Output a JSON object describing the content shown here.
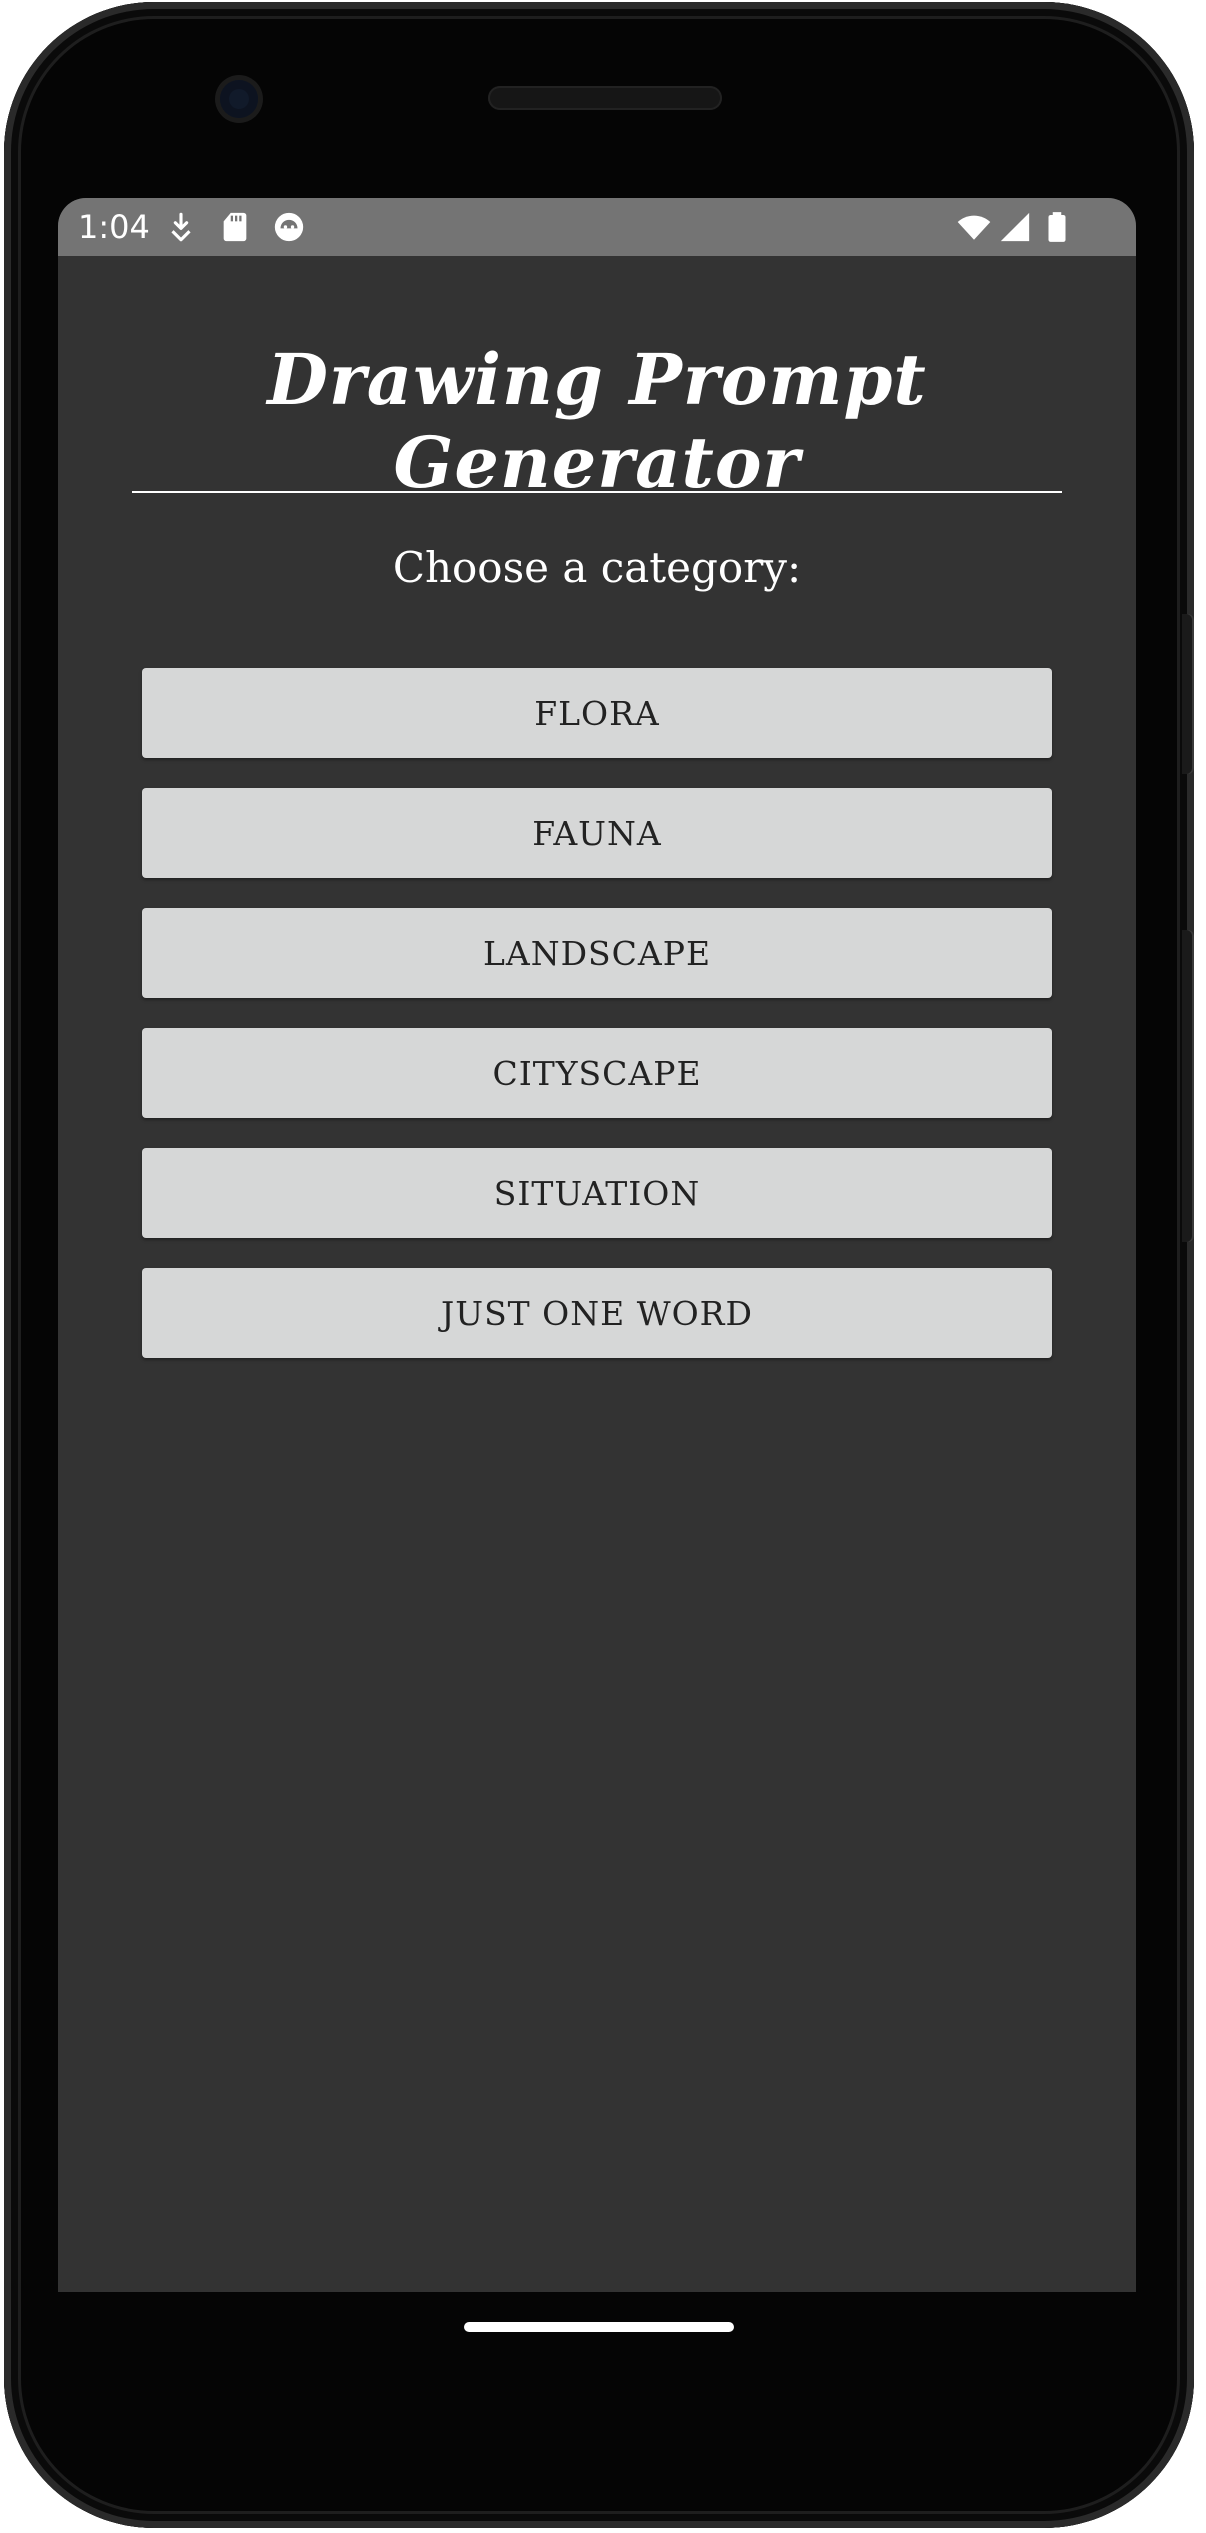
{
  "status_bar": {
    "time": "1:04",
    "left_icons": [
      "download-icon",
      "sd-card-icon",
      "app-notification-icon"
    ],
    "right_icons": [
      "wifi-icon",
      "cell-signal-icon",
      "battery-icon"
    ]
  },
  "app": {
    "title": "Drawing Prompt Generator",
    "subtitle": "Choose a category:",
    "categories": [
      {
        "label": "FLORA"
      },
      {
        "label": "FAUNA"
      },
      {
        "label": "LANDSCAPE"
      },
      {
        "label": "CITYSCAPE"
      },
      {
        "label": "SITUATION"
      },
      {
        "label": "JUST ONE WORD"
      }
    ]
  },
  "colors": {
    "screen_background": "#333333",
    "status_bar": "#747474",
    "button_background": "#d6d7d7",
    "button_text": "#222222",
    "text": "#ffffff"
  }
}
